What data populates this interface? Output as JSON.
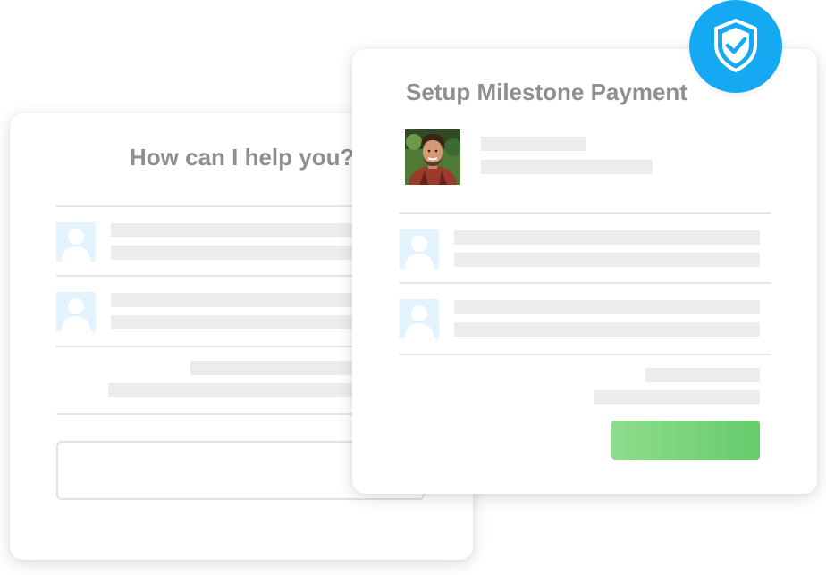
{
  "help_card": {
    "title": "How can I help you?"
  },
  "milestone_card": {
    "title": "Setup Milestone Payment"
  },
  "colors": {
    "accent_blue": "#15a9f4",
    "button_green": "#6fcf6f",
    "placeholder_gray": "#ececec",
    "title_gray": "#8f8f8f"
  },
  "icons": {
    "badge": "shield-check-icon",
    "avatar": "user-avatar-icon"
  }
}
